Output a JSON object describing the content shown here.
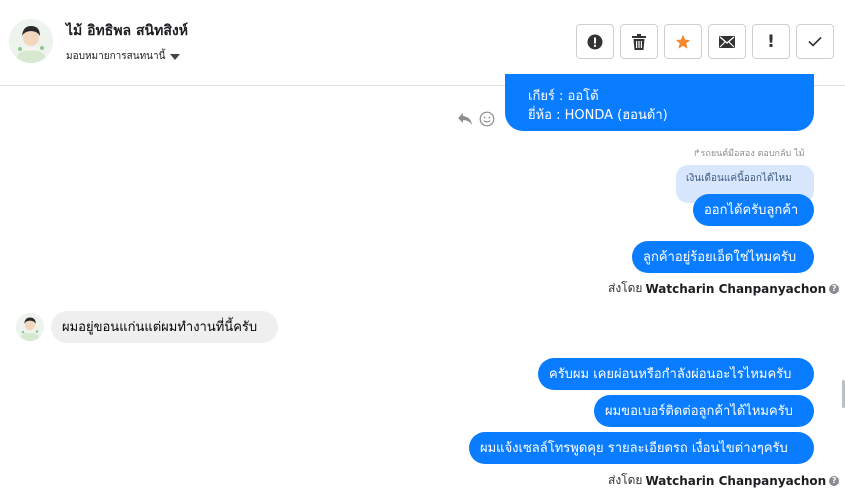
{
  "header": {
    "contact_name": "ไม้ อิทธิพล สนิทสิงห์",
    "assign_label": "มอบหมายการสนทนานี้"
  },
  "actions": {
    "spam_label": "!",
    "done_icon": "check-icon"
  },
  "messages": {
    "prev_line1": "เกียร์ : ออโต้",
    "prev_line2": "ยี่ห้อ : HONDA (ฮอนด้า)",
    "reply_note": "↱รถยนต์มือสอง ตอบกลับ ไม้",
    "quoted_text": "เงินเดือนแค่นี้ออกได้ไหม",
    "out1": "ออกได้ครับลูกค้า",
    "out2": "ลูกค้าอยู่ร้อยเอ็ดใช่ไหมครับ",
    "in1": "ผมอยู่ขอนแก่นแต่ผมทำงานที่นี้ครับ",
    "out3": "ครับผม เคยผ่อนหรือกำลังผ่อนอะไรไหมครับ",
    "out4": "ผมขอเบอร์ติดต่อลูกค้าได้ไหมครับ",
    "out5": "ผมแจ้งเซลล์โทรพูดคุย รายละเอียดรถ เงื่อนไขต่างๆครับ"
  },
  "sent_by": {
    "prefix": "ส่งโดย",
    "agent": "Watcharin Chanpanyachon",
    "help": "?"
  },
  "colors": {
    "outgoing_bubble": "#0a7cff",
    "incoming_bubble": "#efefef",
    "quote_bubble": "#d8e7fd",
    "star": "#f7882f"
  }
}
